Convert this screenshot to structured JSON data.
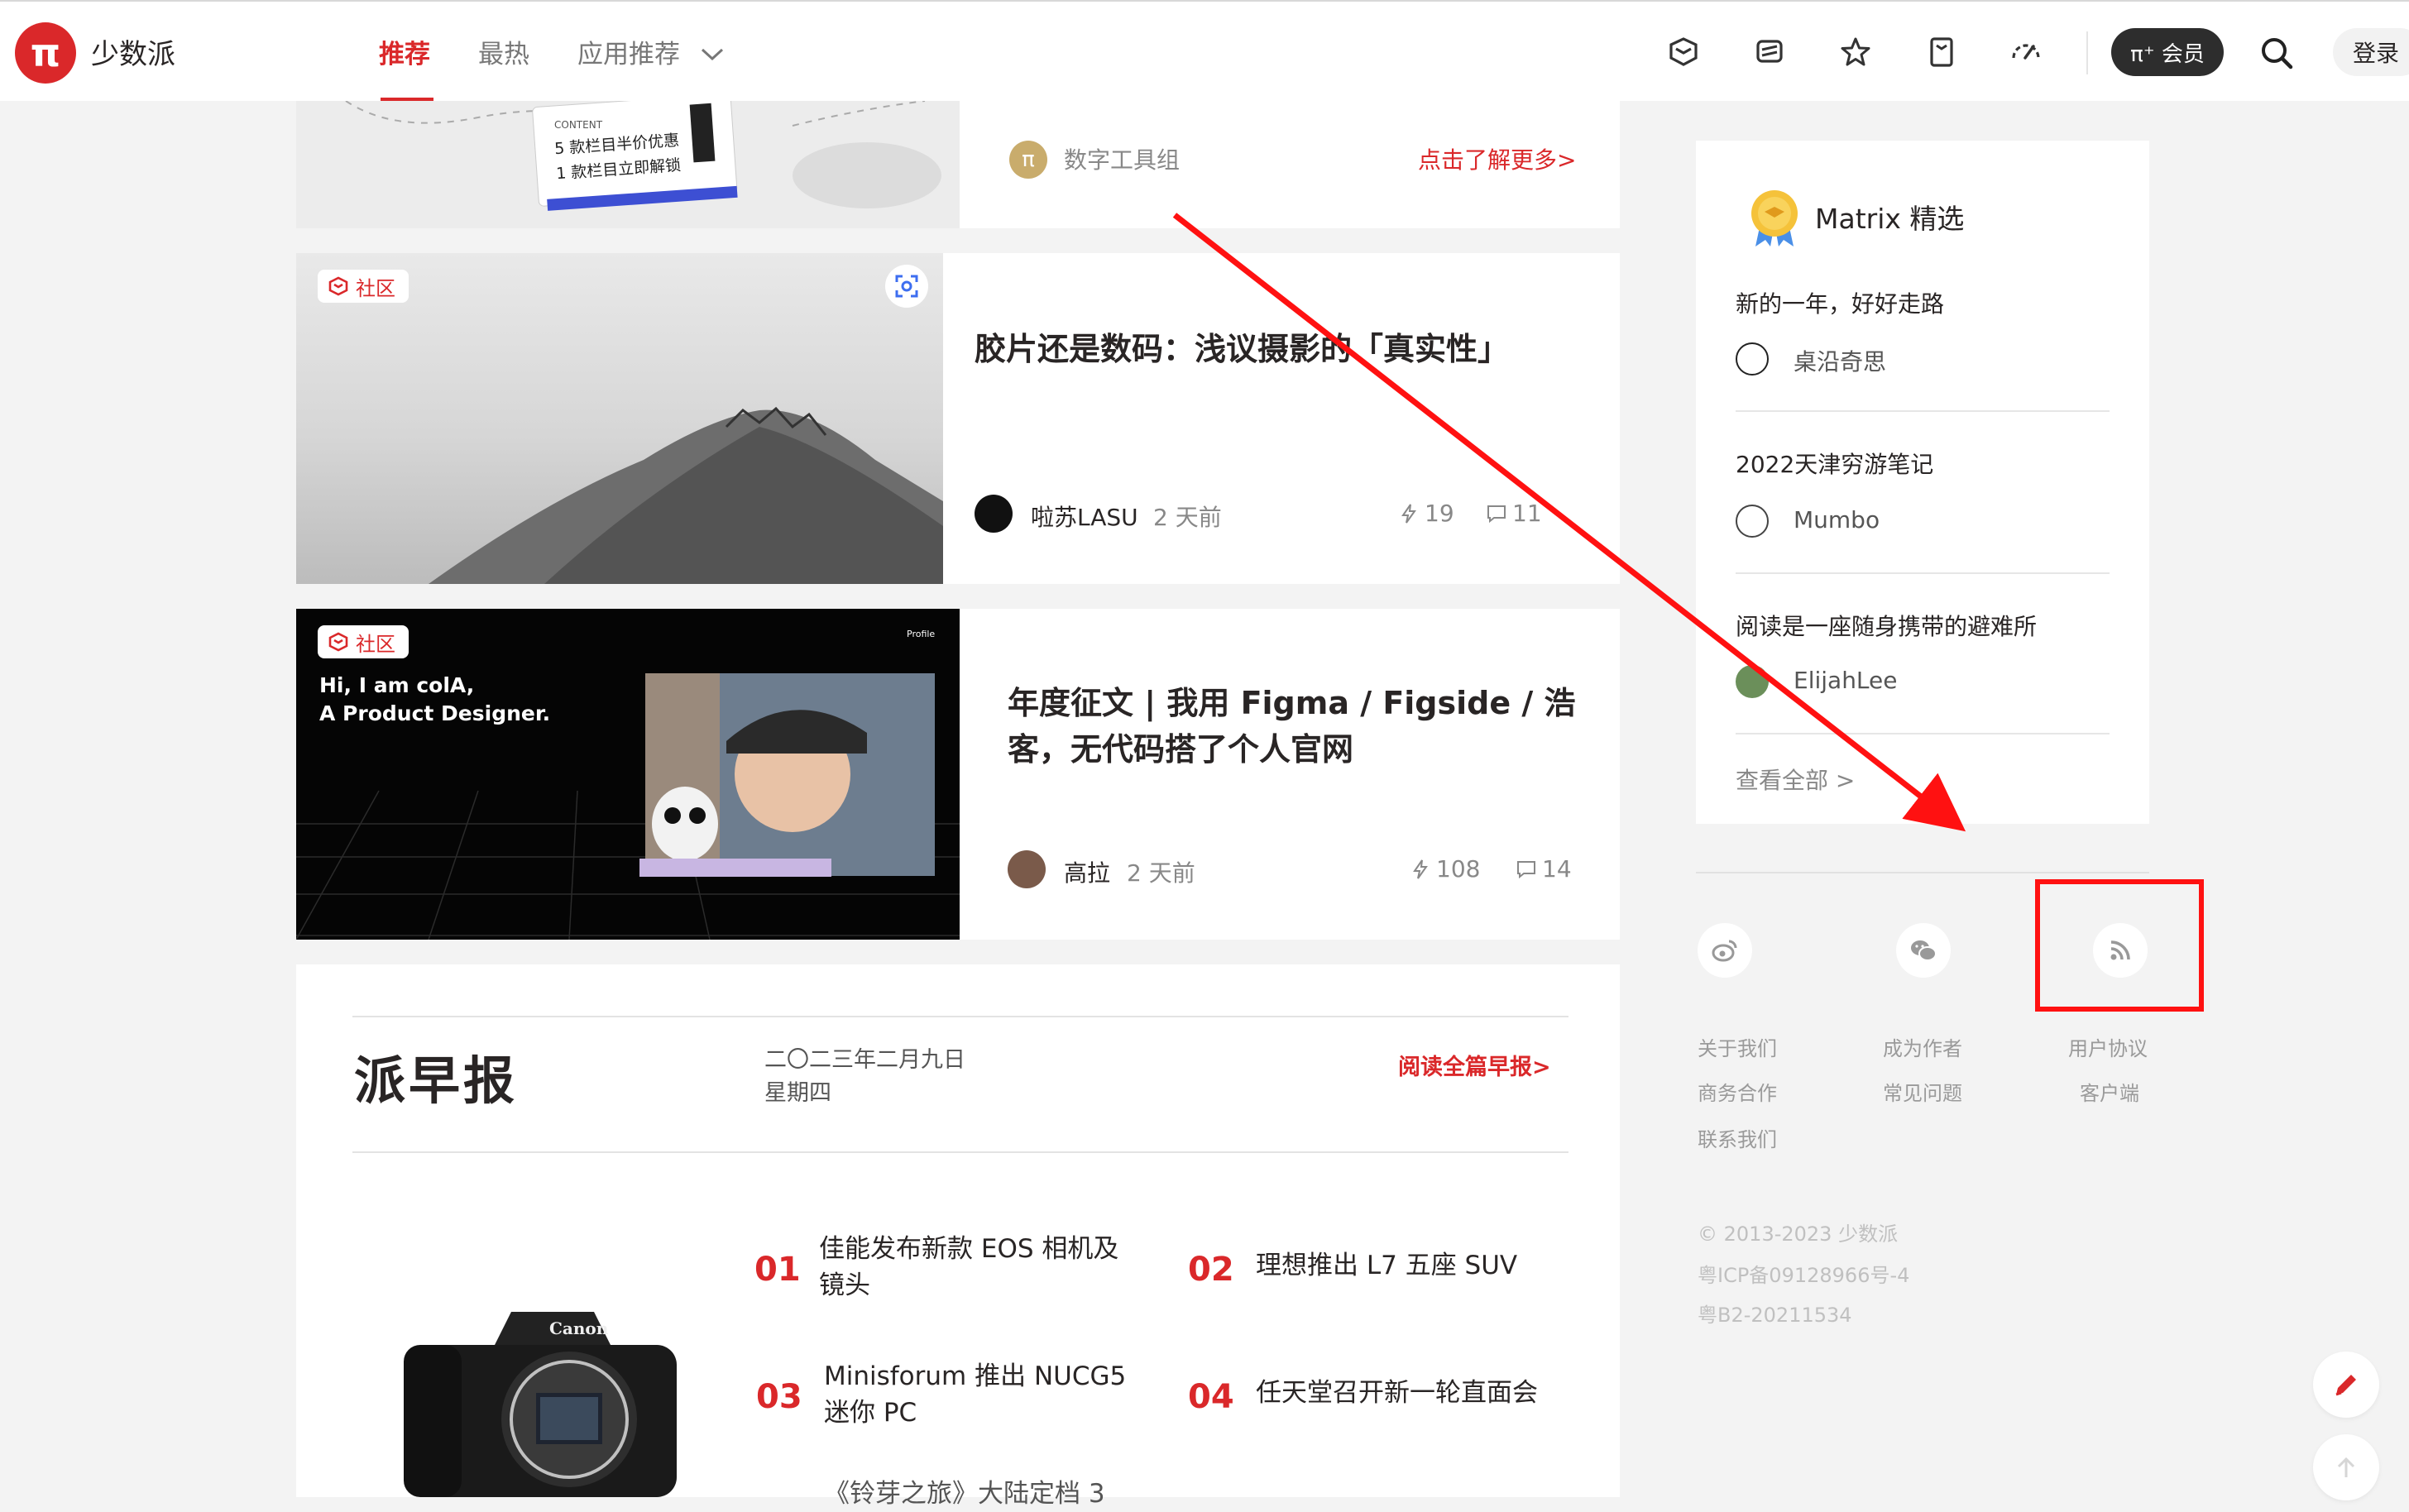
{
  "header": {
    "logo_mark": "π",
    "logo_text": "少数派",
    "nav": [
      "推荐",
      "最热",
      "应用推荐"
    ],
    "tools": [
      "matrix-icon",
      "podcast-icon",
      "star-icon",
      "bookmark-icon",
      "speed-icon"
    ],
    "member_label": "π⁺ 会员",
    "login_label": "登录"
  },
  "top_card": {
    "ticket_line1": "5 款栏目半价优惠",
    "ticket_line2": "1 款栏目立即解锁",
    "ticket_small": "CONTENT",
    "author": "数字工具组",
    "more": "点击了解更多>"
  },
  "articles": [
    {
      "badge": "社区",
      "title": "胶片还是数码：浅议摄影的「真实性」",
      "author": "啦苏LASU",
      "time": "2 天前",
      "likes": "19",
      "comments": "11"
    },
    {
      "badge": "社区",
      "title_line1": "年度征文 | 我用 Figma / Figside / 浩",
      "title_line2": "客，无代码搭了个人官网",
      "author": "高拉",
      "time": "2 天前",
      "likes": "108",
      "comments": "14",
      "image_text_hi": "Hi, I am colA,",
      "image_text_role": "A Product Designer.",
      "image_text_profile": "Profile"
    }
  ],
  "daily": {
    "title": "派早报",
    "date": "二〇二三年二月九日",
    "weekday": "星期四",
    "read_all": "阅读全篇早报>",
    "camera_brand": "Canon",
    "items": [
      {
        "num": "01",
        "text_line1": "佳能发布新款 EOS 相机及",
        "text_line2": "镜头"
      },
      {
        "num": "02",
        "text_line1": "理想推出 L7 五座 SUV",
        "text_line2": ""
      },
      {
        "num": "03",
        "text_line1": "Minisforum 推出 NUCG5",
        "text_line2": "迷你 PC"
      },
      {
        "num": "04",
        "text_line1": "任天堂召开新一轮直面会",
        "text_line2": ""
      }
    ],
    "partial_next": "《铃芽之旅》大陆定档 3"
  },
  "matrix": {
    "title": "Matrix 精选",
    "items": [
      {
        "title": "新的一年，好好走路",
        "author": "桌沿奇思"
      },
      {
        "title": "2022天津穷游笔记",
        "author": "Mumbo"
      },
      {
        "title": "阅读是一座随身携带的避难所",
        "author": "ElijahLee"
      }
    ],
    "view_all": "查看全部 >"
  },
  "footer": {
    "social": [
      "weibo-icon",
      "wechat-icon",
      "rss-icon"
    ],
    "col1": [
      "关于我们",
      "商务合作",
      "联系我们"
    ],
    "col2": [
      "成为作者",
      "常见问题"
    ],
    "col3": [
      "用户协议",
      "客户端"
    ],
    "copyright": "© 2013-2023 少数派",
    "icp1": "粤ICP备09128966号-4",
    "icp2": "粤B2-20211534"
  },
  "colors": {
    "brand_red": "#da282a",
    "annotation_red": "#ff1111"
  }
}
